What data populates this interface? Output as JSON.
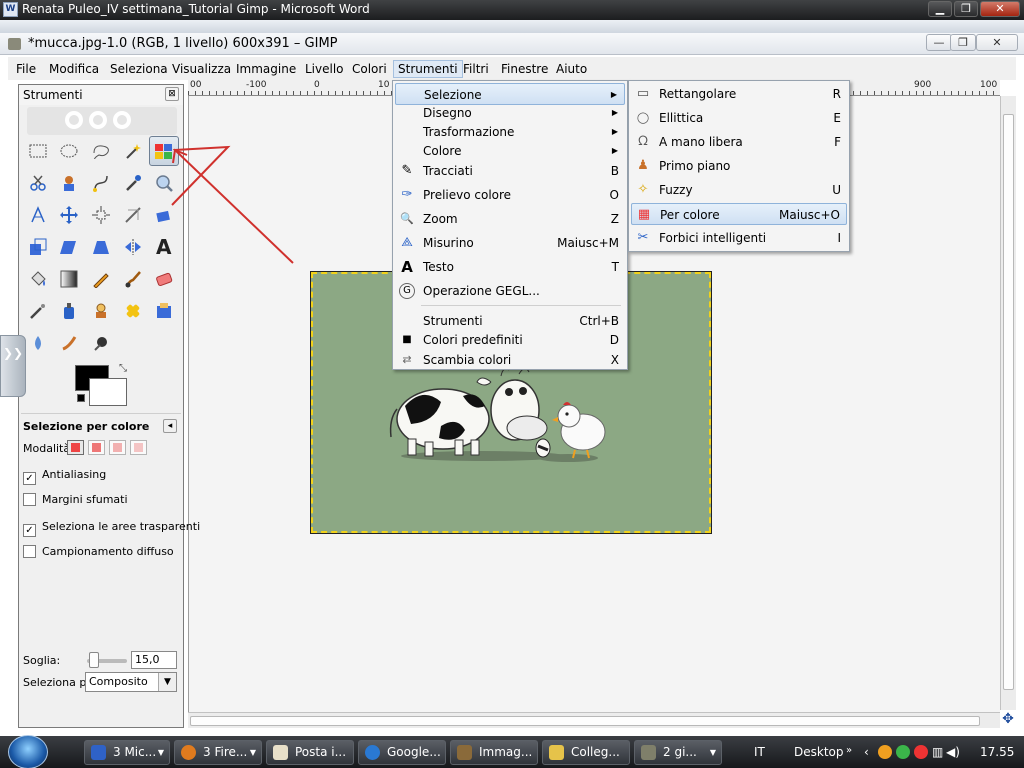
{
  "word_window": {
    "title": "Renata Puleo_IV settimana_Tutorial Gimp - Microsoft Word",
    "icon": "W",
    "min": "▁",
    "max": "❐",
    "close": "✕"
  },
  "gimp_window": {
    "title": "*mucca.jpg-1.0 (RGB, 1 livello) 600x391 – GIMP",
    "min": "—",
    "max": "❐",
    "close": "✕"
  },
  "menubar": [
    {
      "label": "File"
    },
    {
      "label": "Modifica"
    },
    {
      "label": "Seleziona"
    },
    {
      "label": "Visualizza"
    },
    {
      "label": "Immagine"
    },
    {
      "label": "Livello"
    },
    {
      "label": "Colori"
    },
    {
      "label": "Strumenti"
    },
    {
      "label": "Filtri"
    },
    {
      "label": "Finestre"
    },
    {
      "label": "Aiuto"
    }
  ],
  "ruler": [
    "00",
    "-100",
    "0",
    "10",
    "900",
    "100"
  ],
  "toolbox": {
    "title": "Strumenti",
    "close": "⊠"
  },
  "tool_options": {
    "title": "Selezione per colore",
    "mode_label": "Modalità:",
    "antialiasing": "Antialiasing",
    "feather": "Margini sfumati",
    "transparent": "Seleziona le aree trasparenti",
    "sample_merged": "Campionamento diffuso",
    "threshold_label": "Soglia:",
    "threshold_value": "15,0",
    "select_by_label": "Seleziona per:",
    "select_by_value": "Composito"
  },
  "strumenti_menu": {
    "items": [
      {
        "label": "Selezione",
        "accel": "",
        "icon": ""
      },
      {
        "label": "Disegno",
        "accel": "",
        "icon": ""
      },
      {
        "label": "Trasformazione",
        "accel": "",
        "icon": ""
      },
      {
        "label": "Colore",
        "accel": "",
        "icon": ""
      },
      {
        "label": "Tracciati",
        "accel": "B",
        "icon": "✎"
      },
      {
        "label": "Prelievo colore",
        "accel": "O",
        "icon": "✑"
      },
      {
        "label": "Zoom",
        "accel": "Z",
        "icon": "🔍"
      },
      {
        "label": "Misurino",
        "accel": "Maiusc+M",
        "icon": "⟁"
      },
      {
        "label": "Testo",
        "accel": "T",
        "icon": "A"
      },
      {
        "label": "Operazione GEGL...",
        "accel": "",
        "icon": "G"
      },
      {
        "label": "Strumenti",
        "accel": "Ctrl+B",
        "icon": ""
      },
      {
        "label": "Colori predefiniti",
        "accel": "D",
        "icon": "■"
      },
      {
        "label": "Scambia colori",
        "accel": "X",
        "icon": "⇄"
      }
    ]
  },
  "selezione_submenu": {
    "items": [
      {
        "label": "Rettangolare",
        "accel": "R",
        "icon": "▭"
      },
      {
        "label": "Ellittica",
        "accel": "E",
        "icon": "◯"
      },
      {
        "label": "A mano libera",
        "accel": "F",
        "icon": "ᘯ"
      },
      {
        "label": "Primo piano",
        "accel": "",
        "icon": "♟"
      },
      {
        "label": "Fuzzy",
        "accel": "U",
        "icon": "✧"
      },
      {
        "label": "Per colore",
        "accel": "Maiusc+O",
        "icon": "▦"
      },
      {
        "label": "Forbici intelligenti",
        "accel": "I",
        "icon": "✂"
      }
    ]
  },
  "taskbar": {
    "buttons": [
      {
        "label": "3 Mic...",
        "color": "#2f62c7"
      },
      {
        "label": "3 Fire...",
        "color": "#e07b1e"
      },
      {
        "label": "Posta i...",
        "color": "#e8e0c9"
      },
      {
        "label": "Google...",
        "color": "#2a79d3"
      },
      {
        "label": "Immag...",
        "color": "#8a6a3a"
      },
      {
        "label": "Colleg...",
        "color": "#e6c34a"
      },
      {
        "label": "2 gi...",
        "color": "#7f7f6a"
      }
    ],
    "lang": "IT",
    "desktop": "Desktop",
    "clock": "17.55"
  },
  "colors": {
    "canvas_bg": "#8ca884",
    "annotation": "#d0312d",
    "selection_border": "#f2d21a"
  }
}
